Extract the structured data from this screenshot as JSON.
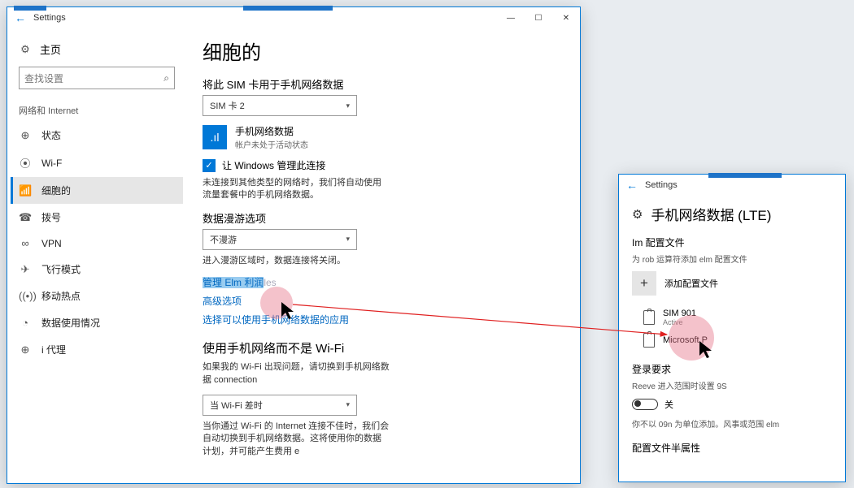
{
  "window_main": {
    "title": "Settings",
    "home_label": "主页",
    "search_placeholder": "查找设置",
    "category": "网络和 Internet",
    "nav": [
      {
        "icon": "status-icon",
        "glyph": "⊕",
        "label": "状态"
      },
      {
        "icon": "wifi-icon",
        "glyph": "⦿",
        "label": "Wi-F"
      },
      {
        "icon": "cellular-icon",
        "glyph": "📶",
        "label": "细胞的",
        "active": true
      },
      {
        "icon": "dialup-icon",
        "glyph": "☎",
        "label": "拨号"
      },
      {
        "icon": "vpn-icon",
        "glyph": "∞",
        "label": "VPN"
      },
      {
        "icon": "airplane-icon",
        "glyph": "✈",
        "label": "飞行模式"
      },
      {
        "icon": "hotspot-icon",
        "glyph": "((•))",
        "label": "移动热点"
      },
      {
        "icon": "datausage-icon",
        "glyph": "◔",
        "label": "数据使用情况"
      },
      {
        "icon": "proxy-icon",
        "glyph": "⊕",
        "label": "i 代理"
      }
    ],
    "page_title": "细胞的",
    "sim_label": "将此 SIM 卡用于手机网络数据",
    "sim_select": "SIM 卡 2",
    "tile_title": "手机网络数据",
    "tile_sub": "帐户未处于活动状态",
    "let_windows_manage": "让 Windows 管理此连接",
    "auto_connect_desc": "未连接到其他类型的网络时，我们将自动使用流量套餐中的手机网络数据。",
    "roaming_label": "数据漫游选项",
    "roaming_select": "不漫游",
    "roaming_desc": "进入漫游区域时，数据连接将关闭。",
    "manage_link": "管理 Elm 利润",
    "manage_link_tail": "les",
    "advanced_link": "高级选项",
    "choose_apps_link": "选择可以使用手机网络数据的应用",
    "use_instead_head": "使用手机网络而不是 Wi-Fi",
    "use_instead_desc": "如果我的 Wi-Fi 出现问题，请切换到手机网络数据 connection",
    "use_instead_select": "当 Wi-Fi 差时",
    "use_instead_desc2": "当你通过 Wi-Fi 的 Internet 连接不佳时，我们会自动切换到手机网络数据。这将使用你的数据计划，并可能产生费用 e"
  },
  "window_small": {
    "title": "Settings",
    "page_title": "手机网络数据 (LTE)",
    "profiles_head": "Im 配置文件",
    "profiles_sub": "为 rob 运算符添加 elm 配置文件",
    "add_profile": "添加配置文件",
    "profiles": [
      {
        "name": "SIM 901",
        "status": "Active"
      },
      {
        "name": "Microsoft P",
        "status": ""
      }
    ],
    "signin_head": "登录要求",
    "signin_sub": "Reeve 进入范围时设置 9S",
    "toggle_label": "关",
    "signin_note": "你不以 09n 为单位添加。风事或范围 elm",
    "props_head": "配置文件半属性"
  }
}
